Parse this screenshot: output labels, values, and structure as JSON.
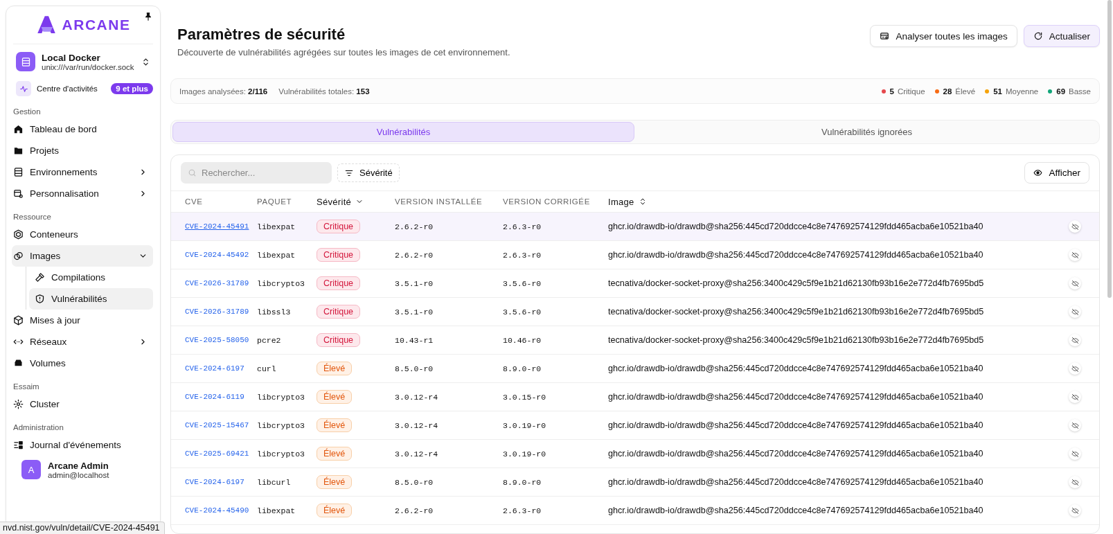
{
  "sidebar": {
    "logo": "ARCANE",
    "environment": {
      "name": "Local Docker",
      "socket": "unix:///var/run/docker.sock"
    },
    "activity": {
      "label": "Centre d'activités",
      "badge": "9 et plus"
    },
    "sections": [
      {
        "title": "Gestion",
        "items": [
          {
            "label": "Tableau de bord",
            "selected": false
          },
          {
            "label": "Projets",
            "selected": false
          },
          {
            "label": "Environnements",
            "selected": false,
            "expanded": false
          },
          {
            "label": "Personnalisation",
            "selected": false,
            "expanded": false
          }
        ]
      },
      {
        "title": "Ressource",
        "items": [
          {
            "label": "Conteneurs",
            "selected": false
          },
          {
            "label": "Images",
            "selected": true,
            "expanded": true,
            "children": [
              {
                "label": "Compilations",
                "selected": false
              },
              {
                "label": "Vulnérabilités",
                "selected": true
              }
            ]
          },
          {
            "label": "Mises à jour",
            "selected": false
          },
          {
            "label": "Réseaux",
            "selected": false,
            "expanded": false
          },
          {
            "label": "Volumes",
            "selected": false
          }
        ]
      },
      {
        "title": "Essaim",
        "items": [
          {
            "label": "Cluster",
            "selected": false
          }
        ]
      },
      {
        "title": "Administration",
        "items": [
          {
            "label": "Journal d'événements",
            "selected": false
          }
        ]
      }
    ],
    "user": {
      "initial": "A",
      "name": "Arcane Admin",
      "email": "admin@localhost"
    }
  },
  "header": {
    "title": "Paramètres de sécurité",
    "subtitle": "Découverte de vulnérabilités agrégées sur toutes les images de cet environnement.",
    "buttons": [
      {
        "label": "Analyser toutes les images",
        "kind": "outline"
      },
      {
        "label": "Actualiser",
        "kind": "soft"
      }
    ]
  },
  "stats": {
    "items": [
      {
        "label": "Images analysées:",
        "value": "2/116"
      },
      {
        "label": "Vulnérabilités totales:",
        "value": "153"
      }
    ],
    "severity_counts": [
      {
        "count": "5",
        "label": "Critique",
        "color": "#e5484d"
      },
      {
        "count": "28",
        "label": "Élevé",
        "color": "#f76b15"
      },
      {
        "count": "51",
        "label": "Moyenne",
        "color": "#f5a30b"
      },
      {
        "count": "69",
        "label": "Basse",
        "color": "#12a67a"
      }
    ]
  },
  "tabs": [
    {
      "label": "Vulnérabilités",
      "selected": true
    },
    {
      "label": "Vulnérabilités ignorées",
      "selected": false
    }
  ],
  "table": {
    "search": {
      "placeholder": "Rechercher..."
    },
    "filter_button": "Sévérité",
    "view_button": "Afficher",
    "columns": [
      {
        "label": "CVE"
      },
      {
        "label": "PAQUET"
      },
      {
        "label": "Sévérité",
        "sortable": true,
        "sorted": true
      },
      {
        "label": "VERSION INSTALLÉE"
      },
      {
        "label": "VERSION CORRIGÉE"
      },
      {
        "label": "Image",
        "sortable": true,
        "sorted": false
      }
    ],
    "rows": [
      {
        "cve": "CVE-2024-45491",
        "package": "libexpat",
        "severity": {
          "label": "Critique",
          "kind": "critical"
        },
        "installed": "2.6.2-r0",
        "fixed": "2.6.3-r0",
        "image": "ghcr.io/drawdb-io/drawdb@sha256:445cd720ddcce4c8e747692574129fdd465acba6e10521ba40",
        "selected": true
      },
      {
        "cve": "CVE-2024-45492",
        "package": "libexpat",
        "severity": {
          "label": "Critique",
          "kind": "critical"
        },
        "installed": "2.6.2-r0",
        "fixed": "2.6.3-r0",
        "image": "ghcr.io/drawdb-io/drawdb@sha256:445cd720ddcce4c8e747692574129fdd465acba6e10521ba40",
        "selected": false
      },
      {
        "cve": "CVE-2026-31789",
        "package": "libcrypto3",
        "severity": {
          "label": "Critique",
          "kind": "critical"
        },
        "installed": "3.5.1-r0",
        "fixed": "3.5.6-r0",
        "image": "tecnativa/docker-socket-proxy@sha256:3400c429c5f9e1b21d62130fb93b16e2e772d4fb7695bd5",
        "selected": false
      },
      {
        "cve": "CVE-2026-31789",
        "package": "libssl3",
        "severity": {
          "label": "Critique",
          "kind": "critical"
        },
        "installed": "3.5.1-r0",
        "fixed": "3.5.6-r0",
        "image": "tecnativa/docker-socket-proxy@sha256:3400c429c5f9e1b21d62130fb93b16e2e772d4fb7695bd5",
        "selected": false
      },
      {
        "cve": "CVE-2025-58050",
        "package": "pcre2",
        "severity": {
          "label": "Critique",
          "kind": "critical"
        },
        "installed": "10.43-r1",
        "fixed": "10.46-r0",
        "image": "tecnativa/docker-socket-proxy@sha256:3400c429c5f9e1b21d62130fb93b16e2e772d4fb7695bd5",
        "selected": false
      },
      {
        "cve": "CVE-2024-6197",
        "package": "curl",
        "severity": {
          "label": "Élevé",
          "kind": "high"
        },
        "installed": "8.5.0-r0",
        "fixed": "8.9.0-r0",
        "image": "ghcr.io/drawdb-io/drawdb@sha256:445cd720ddcce4c8e747692574129fdd465acba6e10521ba40",
        "selected": false
      },
      {
        "cve": "CVE-2024-6119",
        "package": "libcrypto3",
        "severity": {
          "label": "Élevé",
          "kind": "high"
        },
        "installed": "3.0.12-r4",
        "fixed": "3.0.15-r0",
        "image": "ghcr.io/drawdb-io/drawdb@sha256:445cd720ddcce4c8e747692574129fdd465acba6e10521ba40",
        "selected": false
      },
      {
        "cve": "CVE-2025-15467",
        "package": "libcrypto3",
        "severity": {
          "label": "Élevé",
          "kind": "high"
        },
        "installed": "3.0.12-r4",
        "fixed": "3.0.19-r0",
        "image": "ghcr.io/drawdb-io/drawdb@sha256:445cd720ddcce4c8e747692574129fdd465acba6e10521ba40",
        "selected": false
      },
      {
        "cve": "CVE-2025-69421",
        "package": "libcrypto3",
        "severity": {
          "label": "Élevé",
          "kind": "high"
        },
        "installed": "3.0.12-r4",
        "fixed": "3.0.19-r0",
        "image": "ghcr.io/drawdb-io/drawdb@sha256:445cd720ddcce4c8e747692574129fdd465acba6e10521ba40",
        "selected": false
      },
      {
        "cve": "CVE-2024-6197",
        "package": "libcurl",
        "severity": {
          "label": "Élevé",
          "kind": "high"
        },
        "installed": "8.5.0-r0",
        "fixed": "8.9.0-r0",
        "image": "ghcr.io/drawdb-io/drawdb@sha256:445cd720ddcce4c8e747692574129fdd465acba6e10521ba40",
        "selected": false
      },
      {
        "cve": "CVE-2024-45490",
        "package": "libexpat",
        "severity": {
          "label": "Élevé",
          "kind": "high"
        },
        "installed": "2.6.2-r0",
        "fixed": "2.6.3-r0",
        "image": "ghcr.io/drawdb-io/drawdb@sha256:445cd720ddcce4c8e747692574129fdd465acba6e10521ba40",
        "selected": false
      }
    ]
  },
  "status_url": "nvd.nist.gov/vuln/detail/CVE-2024-45491"
}
